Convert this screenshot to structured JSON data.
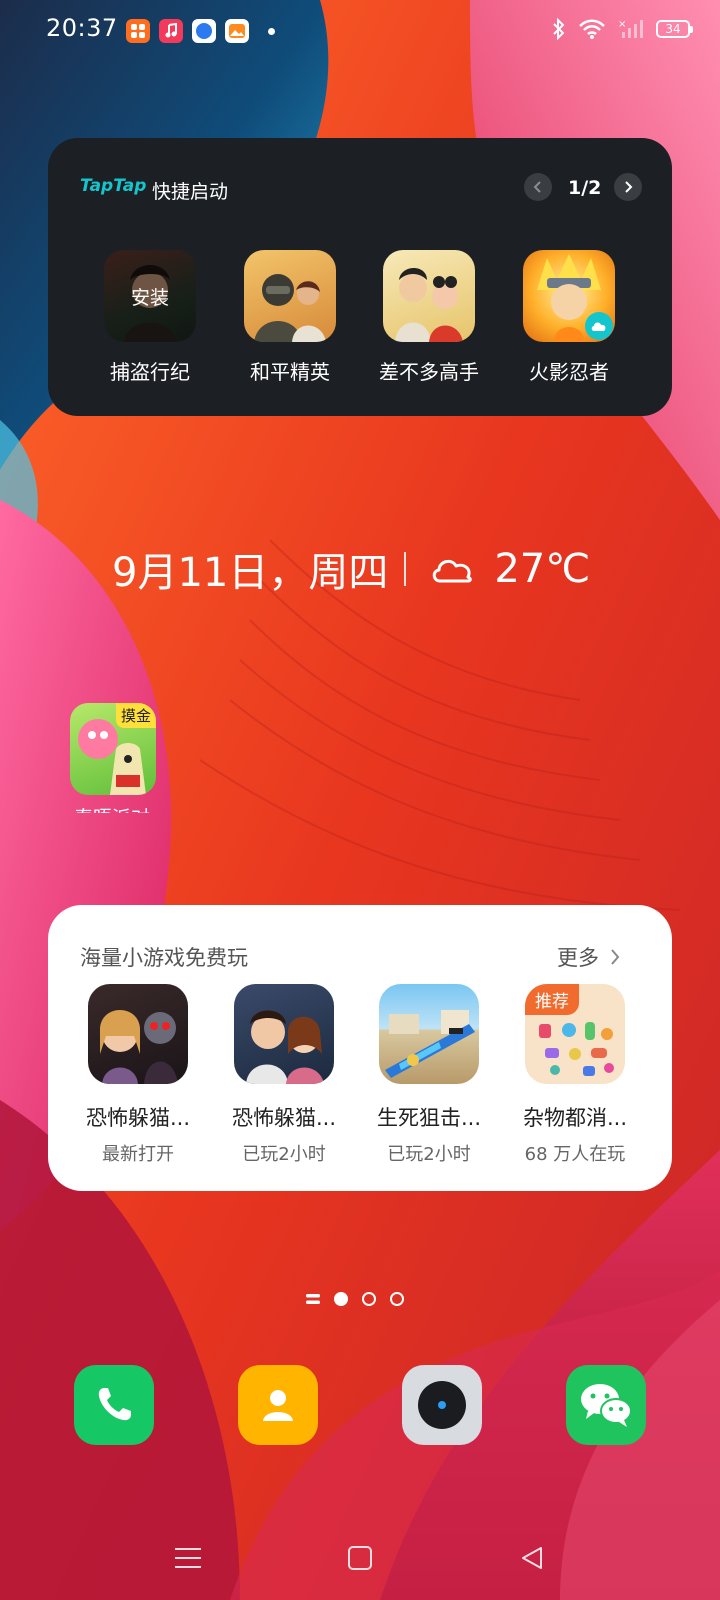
{
  "status_bar": {
    "time": "20:37",
    "battery": "34",
    "notification_icons": [
      "app-store-icon",
      "music-icon",
      "browser-icon",
      "gallery-icon"
    ]
  },
  "taptap_widget": {
    "logo": "TapTap",
    "title": "快捷启动",
    "page": "1/2",
    "games": [
      {
        "label": "捕盗行纪",
        "overlay": "安装"
      },
      {
        "label": "和平精英"
      },
      {
        "label": "差不多高手"
      },
      {
        "label": "火影忍者"
      }
    ]
  },
  "date_weather": {
    "date": "9月11日，周四",
    "temperature": "27℃",
    "weather_icon": "cloud-icon"
  },
  "floating_app": {
    "label": "泰晤派对",
    "badge": "摸金"
  },
  "mini_games": {
    "title": "海量小游戏免费玩",
    "more": "更多",
    "items": [
      {
        "name": "恐怖躲猫...",
        "sub": "最新打开"
      },
      {
        "name": "恐怖躲猫...",
        "sub": "已玩2小时"
      },
      {
        "name": "生死狙击...",
        "sub": "已玩2小时"
      },
      {
        "name": "杂物都消...",
        "sub": "68 万人在玩",
        "badge": "推荐"
      }
    ]
  },
  "page_indicator": {
    "pages": 3,
    "active": 0
  },
  "dock": [
    "phone-app",
    "contacts-app",
    "camera-app",
    "wechat-app"
  ],
  "nav_bar": [
    "menu-button",
    "home-button",
    "back-button"
  ],
  "colors": {
    "taptap_brand": "#15c5ce",
    "widget_dark": "#1c1f23",
    "phone_green": "#16c865",
    "contacts_yellow": "#ffb400",
    "wechat_green": "#1fc45e",
    "badge_orange": "#f26b2e"
  }
}
